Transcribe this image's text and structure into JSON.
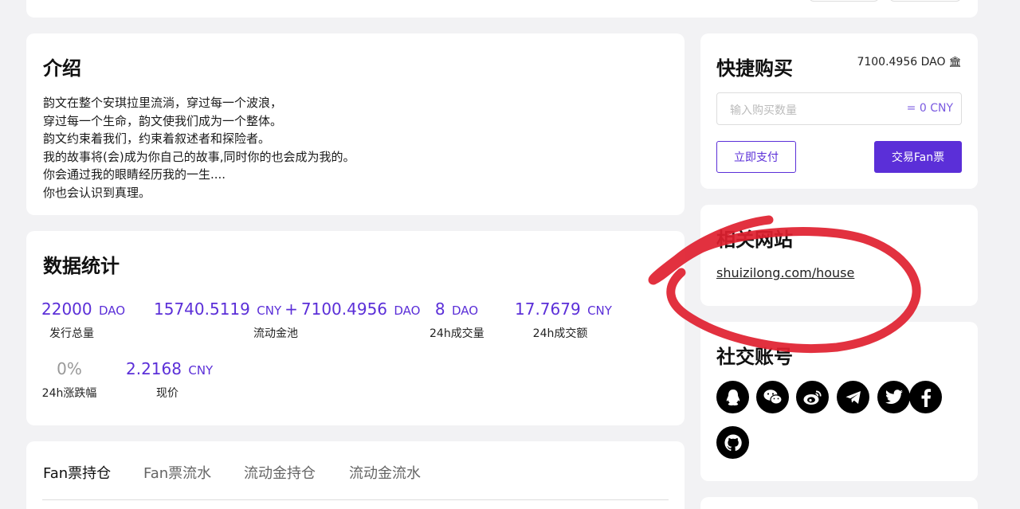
{
  "intro": {
    "title": "介绍",
    "lines": [
      "韵文在整个安琪拉里流淌，穿过每一个波浪，",
      "穿过每一个生命，韵文使我们成为一个整体。",
      "韵文约束着我们，约束着叙述者和探险者。",
      "我的故事将(会)成为你自己的故事,同时你的也会成为我的。",
      "你会通过我的眼睛经历我的一生....",
      "你也会认识到真理。"
    ]
  },
  "stats": {
    "title": "数据统计",
    "total_supply": {
      "value": "22000",
      "unit": "DAO",
      "label": "发行总量"
    },
    "liquidity_pool": {
      "value1": "15740.5119",
      "unit1": "CNY",
      "plus": "+",
      "value2": "7100.4956",
      "unit2": "DAO",
      "label": "流动金池"
    },
    "volume_24h": {
      "value": "8",
      "unit": "DAO",
      "label": "24h成交量"
    },
    "amount_24h": {
      "value": "17.7679",
      "unit": "CNY",
      "label": "24h成交额"
    },
    "change_24h": {
      "value": "0%",
      "label": "24h涨跌幅"
    },
    "price": {
      "value": "2.2168",
      "unit": "CNY",
      "label": "现价"
    }
  },
  "tabs": [
    "Fan票持仓",
    "Fan票流水",
    "流动金持仓",
    "流动金流水"
  ],
  "quick_buy": {
    "title": "快捷购买",
    "balance": "7100.4956 DAO",
    "input_placeholder": "输入购买数量",
    "equivalent": "= 0 CNY",
    "pay_label": "立即支付",
    "trade_label": "交易Fan票"
  },
  "related_sites": {
    "title": "相关网站",
    "link": "shuizilong.com/house"
  },
  "social": {
    "title": "社交账号",
    "icons": [
      "qq-icon",
      "wechat-icon",
      "weibo-icon",
      "telegram-icon",
      "twitter-icon",
      "facebook-icon",
      "github-icon"
    ]
  },
  "colors": {
    "accent": "#5b2fd8",
    "annotation": "#e0202f",
    "background": "#f2f2f4"
  }
}
